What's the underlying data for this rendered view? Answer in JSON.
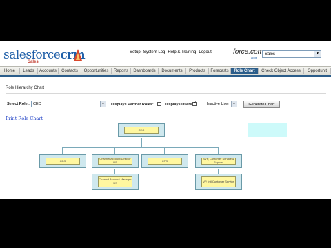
{
  "header": {
    "logo_word": "salesforce",
    "logo_suffix": "crm",
    "logo_sub": "Sales",
    "links": [
      "Setup",
      "System Log",
      "Help & Training",
      "Logout"
    ],
    "brand": "force.com",
    "brand_sub": "apps",
    "app_selected": "Sales"
  },
  "tabs": [
    {
      "label": "Home"
    },
    {
      "label": "Leads"
    },
    {
      "label": "Accounts"
    },
    {
      "label": "Contacts"
    },
    {
      "label": "Opportunities"
    },
    {
      "label": "Reports"
    },
    {
      "label": "Dashboards"
    },
    {
      "label": "Documents"
    },
    {
      "label": "Products"
    },
    {
      "label": "Forecasts"
    },
    {
      "label": "Role Chart"
    },
    {
      "label": "Check Object Access"
    },
    {
      "label": "Opportunit"
    }
  ],
  "active_tab": "Role Chart",
  "page": {
    "title": "Role Hierarchy Chart",
    "select_role_label": "Select Role :",
    "select_role_value": "CEO",
    "partner_roles_label": "Displays Partner Roles:",
    "partner_roles_checked": false,
    "users_label": "Displays Users:",
    "users_checked": true,
    "user_filter_value": "Inactive User",
    "generate_button": "Generate Chart",
    "print_link": "Print Role Chart"
  },
  "org_chart": {
    "root": "CEO",
    "level2": [
      "CEO",
      "Channel Account Director US",
      "CFO",
      "SVP, Customer Service & Support"
    ],
    "level3": [
      "Channel Account Manager US",
      "VP, Intl Customer Service"
    ]
  }
}
